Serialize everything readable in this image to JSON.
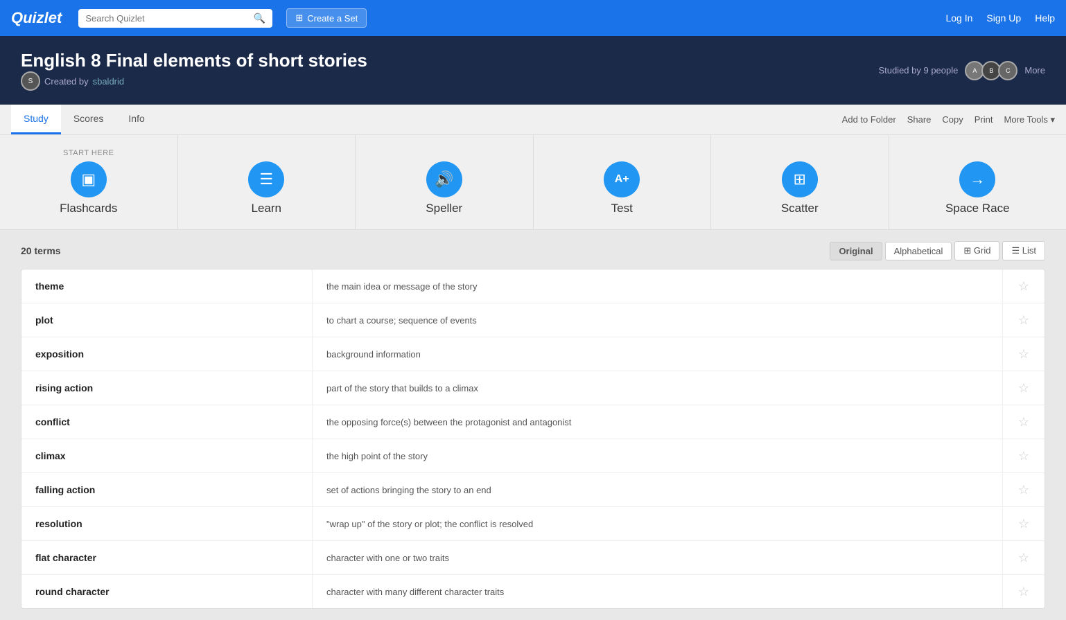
{
  "topnav": {
    "logo": "Quizlet",
    "search_placeholder": "Search Quizlet",
    "create_set_label": "Create a Set",
    "login": "Log In",
    "signup": "Sign Up",
    "help": "Help"
  },
  "header": {
    "title": "English 8 Final elements of short stories",
    "created_by_label": "Created by",
    "creator": "sbaldrid",
    "studied_label": "Studied by 9 people",
    "more": "More"
  },
  "subnav": {
    "tabs": [
      "Study",
      "Scores",
      "Info"
    ],
    "active_tab": "Study",
    "actions": [
      "Add to Folder",
      "Share",
      "Copy",
      "Print",
      "More Tools ▾"
    ]
  },
  "study_modes": [
    {
      "id": "flashcards",
      "icon": "▣",
      "label": "Flashcards",
      "sublabel": "START HERE"
    },
    {
      "id": "learn",
      "icon": "☰",
      "label": "Learn",
      "sublabel": ""
    },
    {
      "id": "speller",
      "icon": "🔊",
      "label": "Speller",
      "sublabel": ""
    },
    {
      "id": "test",
      "icon": "A+",
      "label": "Test",
      "sublabel": ""
    },
    {
      "id": "scatter",
      "icon": "⊞",
      "label": "Scatter",
      "sublabel": ""
    },
    {
      "id": "spacerace",
      "icon": "→",
      "label": "Space Race",
      "sublabel": ""
    }
  ],
  "terms_section": {
    "count_label": "20 terms",
    "views": [
      "Original",
      "Alphabetical",
      "Grid",
      "List"
    ],
    "active_view": "Original",
    "terms": [
      {
        "word": "theme",
        "definition": "the main idea or message of the story"
      },
      {
        "word": "plot",
        "definition": "to chart a course; sequence of events"
      },
      {
        "word": "exposition",
        "definition": "background information"
      },
      {
        "word": "rising action",
        "definition": "part of the story that builds to a climax"
      },
      {
        "word": "conflict",
        "definition": "the opposing force(s) between the protagonist and antagonist"
      },
      {
        "word": "climax",
        "definition": "the high point of the story"
      },
      {
        "word": "falling action",
        "definition": "set of actions bringing the story to an end"
      },
      {
        "word": "resolution",
        "definition": "\"wrap up\" of the story or plot; the conflict is resolved"
      },
      {
        "word": "flat character",
        "definition": "character with one or two traits"
      },
      {
        "word": "round character",
        "definition": "character with many different character traits"
      }
    ]
  }
}
